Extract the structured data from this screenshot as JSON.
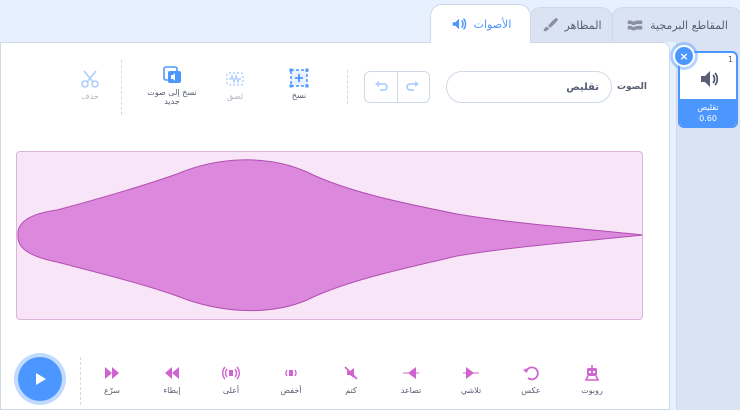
{
  "tabs": [
    {
      "label": "المقاطع البرمجية",
      "icon": "code-blocks-icon"
    },
    {
      "label": "المظاهر",
      "icon": "paintbrush-icon"
    },
    {
      "label": "الأصوات",
      "icon": "speaker-icon"
    }
  ],
  "toolbar": {
    "sound_label": "الصوت",
    "sound_name": "تقليص",
    "copy_label": "نسخ",
    "paste_label": "لصق",
    "copy_to_new_label": "نسخ إلى صوت جديد",
    "delete_label": "حذف"
  },
  "effects": [
    {
      "label": "سرّع",
      "icon": "faster-icon"
    },
    {
      "label": "إبطاء",
      "icon": "slower-icon"
    },
    {
      "label": "أعلى",
      "icon": "louder-icon"
    },
    {
      "label": "أخفض",
      "icon": "softer-icon"
    },
    {
      "label": "كتم",
      "icon": "mute-icon"
    },
    {
      "label": "تصاعد",
      "icon": "fade-in-icon"
    },
    {
      "label": "تلاشي",
      "icon": "fade-out-icon"
    },
    {
      "label": "عكس",
      "icon": "reverse-icon"
    },
    {
      "label": "روبوت",
      "icon": "robot-icon"
    }
  ],
  "sound_list": [
    {
      "index": "1",
      "name": "تقليص",
      "duration": "0.60"
    }
  ],
  "colors": {
    "accent": "#4c97ff",
    "effect": "#cf63cf",
    "wave_fill": "#dc88dc",
    "wave_bg": "#f8e6f8"
  }
}
